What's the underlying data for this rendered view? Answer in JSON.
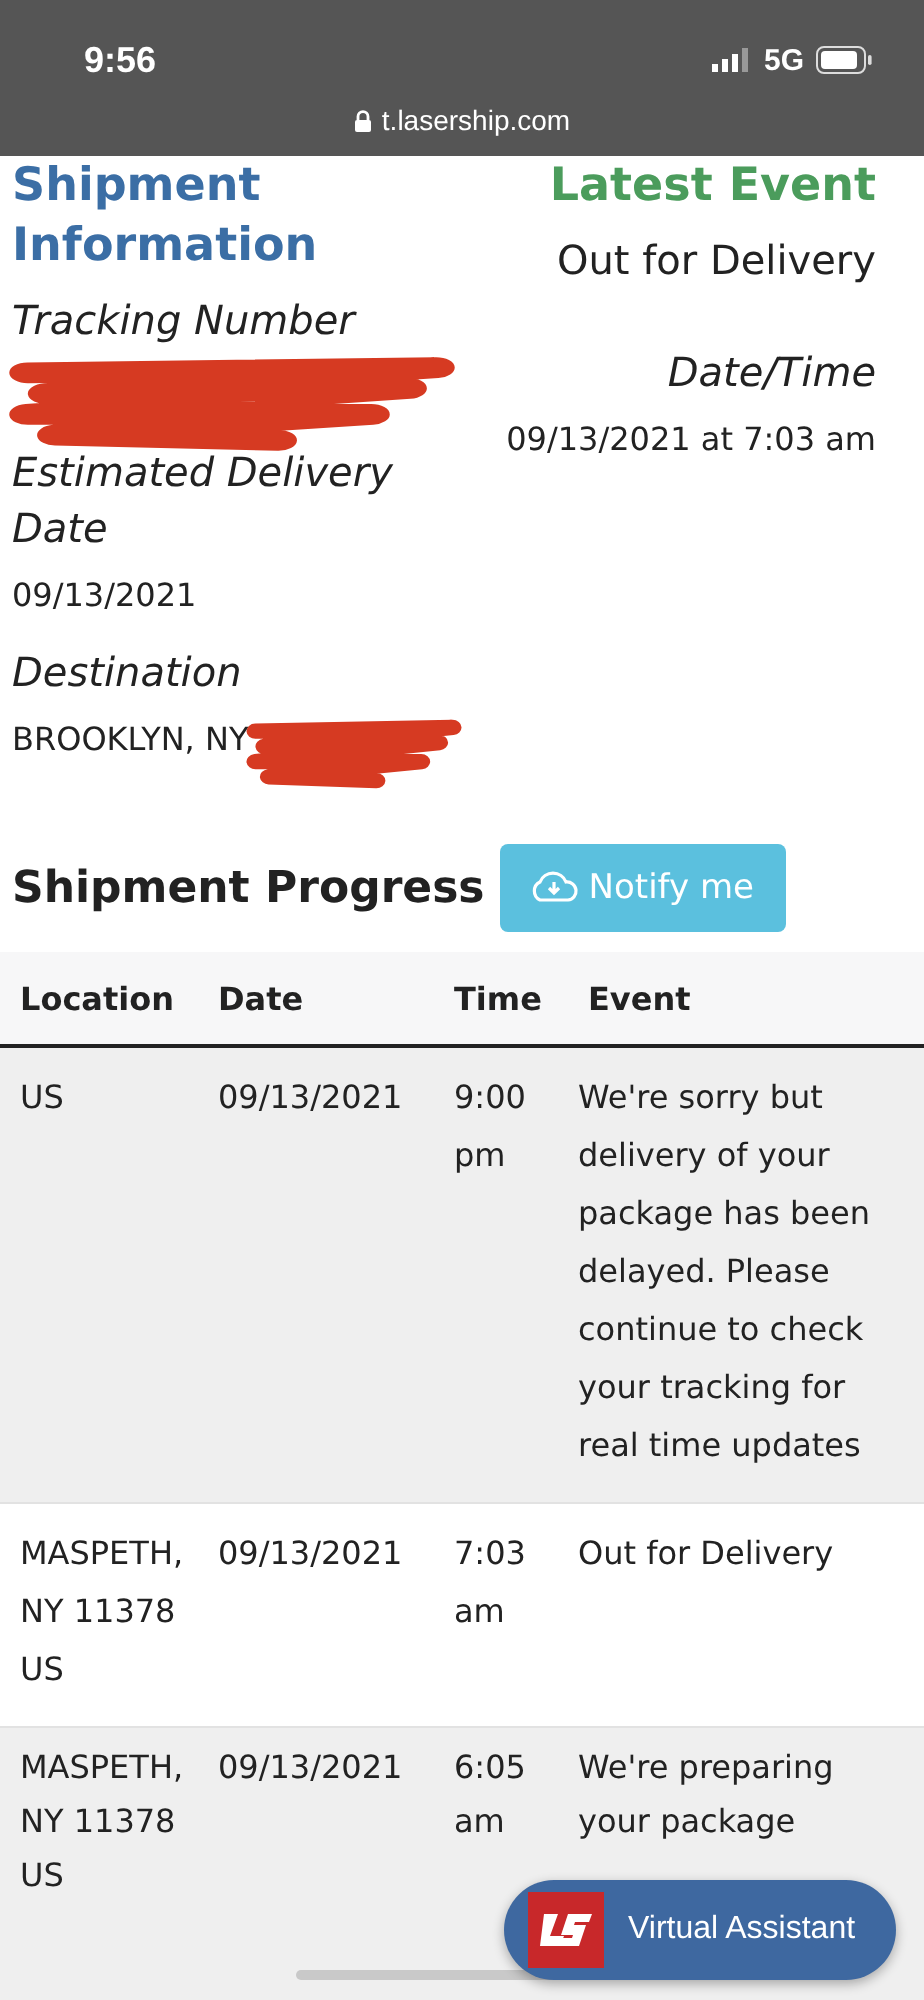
{
  "status_bar": {
    "time": "9:56",
    "network": "5G",
    "url": "t.lasership.com"
  },
  "shipment_info": {
    "title": "Shipment Information",
    "fields": [
      {
        "label": "Tracking Number",
        "redacted": true
      },
      {
        "label": "Estimated Delivery Date",
        "value": "09/13/2021"
      },
      {
        "label": "Destination",
        "value": "BROOKLYN, NY",
        "redacted": true
      }
    ]
  },
  "latest_event": {
    "title": "Latest Event",
    "event": "Out for Delivery",
    "datetime_label": "Date/Time",
    "datetime": "09/13/2021 at 7:03 am"
  },
  "progress": {
    "title": "Shipment Progress",
    "notify_button": "Notify me"
  },
  "table": {
    "columns": [
      "Location",
      "Date",
      "Time",
      "Event"
    ],
    "rows": [
      {
        "location": "US",
        "date": "09/13/2021",
        "time": "9:00 pm",
        "event": "We're sorry but delivery of your package has been delayed. Please continue to check your tracking for real time updates"
      },
      {
        "location": "MASPETH, NY 11378 US",
        "date": "09/13/2021",
        "time": "7:03 am",
        "event": "Out for Delivery"
      },
      {
        "location": "MASPETH, NY 11378 US",
        "date": "09/13/2021",
        "time": "6:05 am",
        "event": "We're preparing your package"
      }
    ]
  },
  "assistant": {
    "label": "Virtual Assistant"
  }
}
